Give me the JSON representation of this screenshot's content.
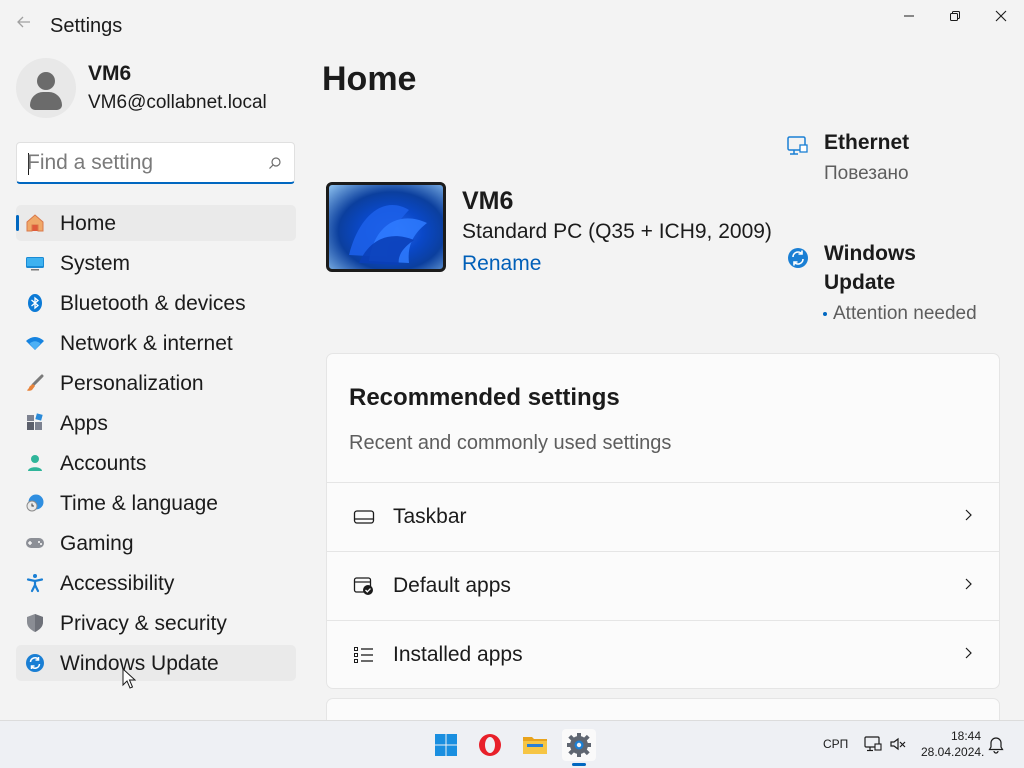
{
  "window": {
    "title": "Settings",
    "controls": {
      "minimize": "minimize-icon",
      "restore": "restore-icon",
      "close": "close-icon"
    }
  },
  "profile": {
    "name": "VM6",
    "email": "VM6@collabnet.local"
  },
  "search": {
    "placeholder": "Find a setting",
    "value": ""
  },
  "sidebar": {
    "items": [
      {
        "label": "Home",
        "icon": "home-icon",
        "active": true
      },
      {
        "label": "System",
        "icon": "system-icon"
      },
      {
        "label": "Bluetooth & devices",
        "icon": "bluetooth-icon"
      },
      {
        "label": "Network & internet",
        "icon": "wifi-icon"
      },
      {
        "label": "Personalization",
        "icon": "brush-icon"
      },
      {
        "label": "Apps",
        "icon": "apps-icon"
      },
      {
        "label": "Accounts",
        "icon": "accounts-icon"
      },
      {
        "label": "Time & language",
        "icon": "clock-globe-icon"
      },
      {
        "label": "Gaming",
        "icon": "gamepad-icon"
      },
      {
        "label": "Accessibility",
        "icon": "accessibility-icon"
      },
      {
        "label": "Privacy & security",
        "icon": "shield-icon"
      },
      {
        "label": "Windows Update",
        "icon": "update-icon",
        "hover": true
      }
    ]
  },
  "main": {
    "title": "Home",
    "device": {
      "name": "VM6",
      "model": "Standard PC (Q35 + ICH9, 2009)",
      "rename_label": "Rename"
    },
    "status": {
      "network_title": "Ethernet",
      "network_sub": "Повезано",
      "update_title_line1": "Windows",
      "update_title_line2": "Update",
      "update_sub": "Attention needed"
    },
    "recommended": {
      "title": "Recommended settings",
      "subtitle": "Recent and commonly used settings",
      "rows": [
        {
          "label": "Taskbar",
          "icon": "taskbar-icon"
        },
        {
          "label": "Default apps",
          "icon": "default-apps-icon"
        },
        {
          "label": "Installed apps",
          "icon": "list-icon"
        }
      ]
    }
  },
  "taskbar": {
    "apps": [
      "start-icon",
      "opera-icon",
      "file-explorer-icon",
      "settings-icon"
    ],
    "language": "СРП",
    "time": "18:44",
    "date": "28.04.2024."
  },
  "colors": {
    "accent": "#0067c0",
    "link": "#005fb8",
    "background": "#f3f3f3",
    "card": "#fbfbfb"
  }
}
